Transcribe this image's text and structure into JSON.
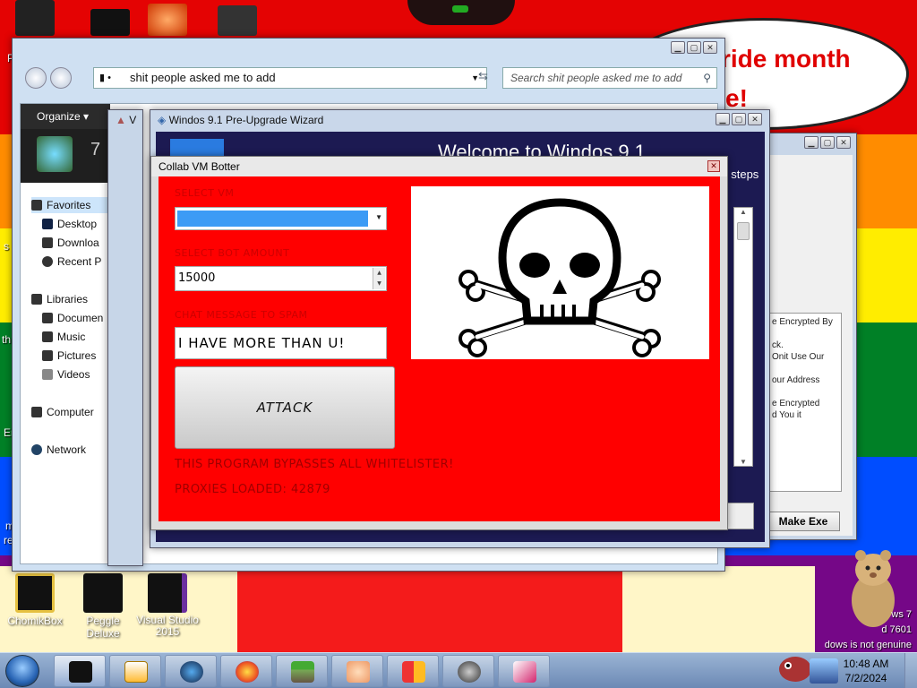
{
  "desktop": {
    "speech_bubble": {
      "line1": "ride month",
      "line2": "e!"
    },
    "icons": [
      {
        "label": "ChomikBox"
      },
      {
        "label": "Peggle Deluxe"
      },
      {
        "label": "Visual Studio 2015"
      }
    ],
    "left_edge_labels": [
      "P",
      "s",
      "th",
      "Er",
      "m",
      "re"
    ],
    "activation": {
      "line1": "ws 7",
      "line2": "d 7601",
      "line3": "dows is not genuine"
    }
  },
  "explorer": {
    "address": "shit people asked me to add",
    "search_placeholder": "Search shit people asked me to add",
    "toolbar": {
      "organize": "Organize ▾"
    },
    "library_count": "7",
    "nav": {
      "favorites": "Favorites",
      "desktop": "Desktop",
      "downloads": "Downloa",
      "recent": "Recent P",
      "libraries": "Libraries",
      "documents": "Documen",
      "music": "Music",
      "pictures": "Pictures",
      "videos": "Videos",
      "computer": "Computer",
      "network": "Network"
    }
  },
  "vm_window": {
    "title": "V"
  },
  "wizard": {
    "title": "Windos 9.1 Pre-Upgrade Wizard",
    "welcome": "Welcome to Windos 9.1",
    "steps_text": "t steps"
  },
  "make_exe": {
    "list_text": "e Encrypted By\n\nck.\nOnit Use Our\n\nour Address\n\ne Encrypted\nd You it",
    "button": "Make Exe"
  },
  "botter": {
    "title": "Collab VM Botter",
    "select_vm_label": "SELECT VM",
    "select_bot_label": "SELECT BOT AMOUNT",
    "bot_amount": "15000",
    "chat_label": "CHAT MESSAGE TO SPAM",
    "chat_message": "I HAVE MORE THAN U!",
    "attack_button": "ATTACK",
    "bypass_text": "THIS PROGRAM BYPASSES ALL WHITELISTER!",
    "proxies_text": "PROXIES LOADED: 42879",
    "accent_color": "#ff0000",
    "select_fill_color": "#3c9bf5"
  },
  "taskbar": {
    "clock_time": "10:48 AM",
    "clock_date": "7/2/2024",
    "apps": [
      {
        "name": "black-app"
      },
      {
        "name": "media-player"
      },
      {
        "name": "globe-app"
      },
      {
        "name": "firefox"
      },
      {
        "name": "minecraft"
      },
      {
        "name": "doctor-app"
      },
      {
        "name": "office-app"
      },
      {
        "name": "skull-app"
      },
      {
        "name": "photo-app"
      }
    ]
  }
}
